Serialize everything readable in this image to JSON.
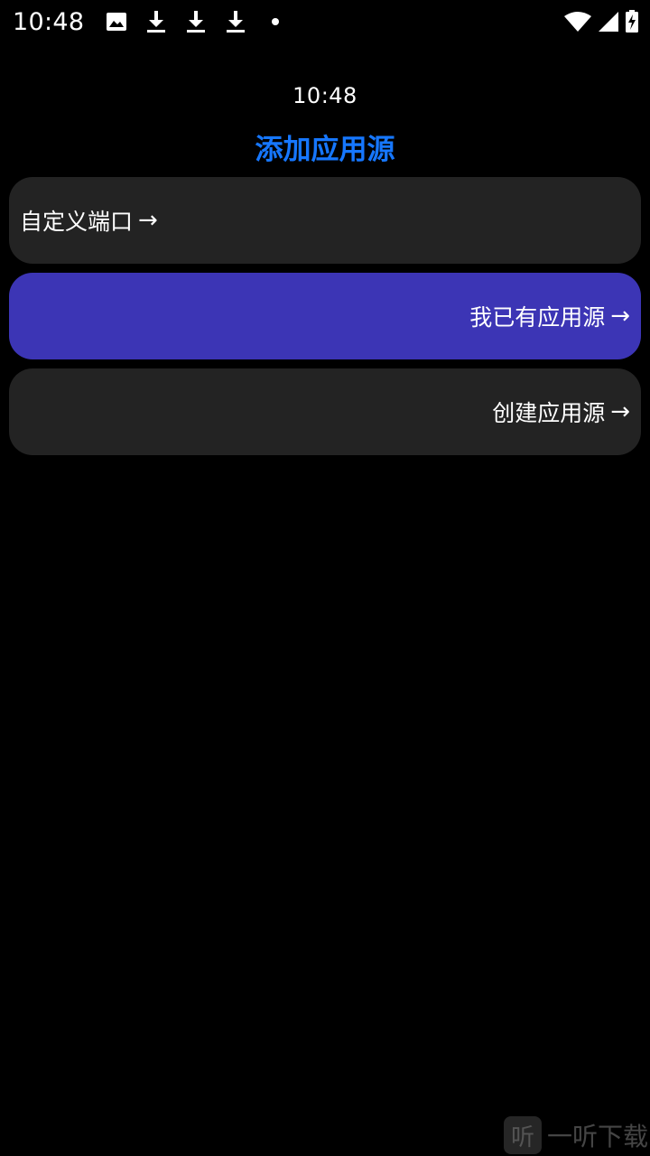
{
  "status_bar": {
    "time": "10:48",
    "notification_icons": [
      "image-icon",
      "download-icon",
      "download-icon",
      "download-icon",
      "dot-icon"
    ],
    "system_icons": [
      "wifi-icon",
      "signal-icon",
      "battery-charging-icon"
    ]
  },
  "header": {
    "clock": "10:48",
    "title": "添加应用源"
  },
  "options": [
    {
      "label": "自定义端口",
      "arrow": "→"
    },
    {
      "label": "我已有应用源",
      "arrow": "→"
    },
    {
      "label": "创建应用源",
      "arrow": "→"
    }
  ],
  "colors": {
    "background": "#000000",
    "title": "#1677ff",
    "card": "#232323",
    "card_selected": "#3c35b5",
    "text": "#ffffff"
  },
  "watermark": {
    "badge": "听",
    "text": "一听下载"
  }
}
